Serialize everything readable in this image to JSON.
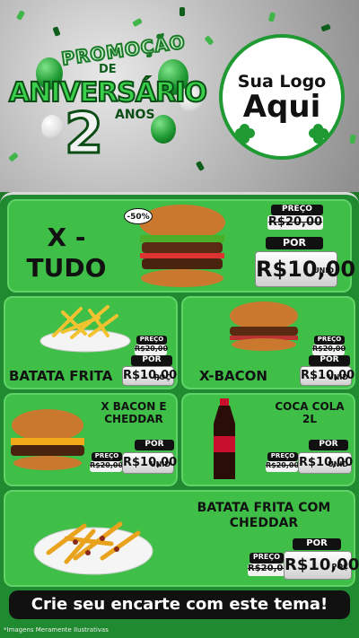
{
  "header": {
    "promo": "PROMOÇÃO",
    "de": "DE",
    "aniversario": "ANIVERSÁRIO",
    "number": "2",
    "anos": "ANOS",
    "logo_line1": "Sua Logo",
    "logo_line2": "Aqui"
  },
  "products": [
    {
      "name": "X - TUDO",
      "badge": "-50%",
      "price_label": "PREÇO",
      "old_price": "R$20,00",
      "por_label": "POR",
      "price": "R$10,00",
      "unit": "UNID"
    },
    {
      "name": "BATATA FRITA",
      "price_label": "PREÇO",
      "old_price": "R$20,00",
      "por_label": "POR",
      "price": "R$10,00",
      "unit": "POÇ"
    },
    {
      "name": "X-BACON",
      "price_label": "PREÇO",
      "old_price": "R$20,00",
      "por_label": "POR",
      "price": "R$10,00",
      "unit": "UNID"
    },
    {
      "name": "X BACON E CHEDDAR",
      "price_label": "PREÇO",
      "old_price": "R$20,00",
      "por_label": "POR",
      "price": "R$10,00",
      "unit": "UNID"
    },
    {
      "name": "COCA COLA 2L",
      "price_label": "PREÇO",
      "old_price": "R$20,00",
      "por_label": "POR",
      "price": "R$10,00",
      "unit": "UNID"
    },
    {
      "name": "BATATA FRITA COM CHEDDAR",
      "price_label": "PREÇO",
      "old_price": "R$20,00",
      "por_label": "POR",
      "price": "R$10,00",
      "unit": "POÇ"
    }
  ],
  "cta": "Crie seu encarte com este tema!",
  "note": "*Imagens Meramente Ilustrativas",
  "colors": {
    "green": "#3fbf48",
    "dark_green": "#1f8a2f",
    "black": "#111111"
  }
}
